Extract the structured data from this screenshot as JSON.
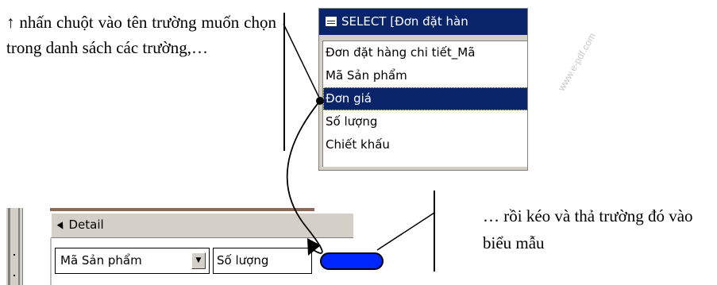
{
  "caption_left": "↑ nhấn chuột vào tên trường muốn chọn trong danh sách các trường,…",
  "caption_right": "… rồi kéo và thả trường đó vào biểu mẫu",
  "field_list": {
    "title": "SELECT [Đơn đặt hàn",
    "items": [
      {
        "label": "Đơn đặt hàng chi tiết_Mã",
        "selected": false
      },
      {
        "label": "Mã Sản phẩm",
        "selected": false
      },
      {
        "label": "Đơn giá",
        "selected": true
      },
      {
        "label": "Số lượng",
        "selected": false
      },
      {
        "label": "Chiết khấu",
        "selected": false
      }
    ]
  },
  "form_design": {
    "section_label": "Detail",
    "combo_value": "Mã Sản phẩm",
    "textbox_value": "Số lượng"
  },
  "colors": {
    "title_bar": "#0a246a",
    "selection": "#0a246a",
    "dropped_control": "#0026ff",
    "window_face": "#d4d0c8"
  }
}
